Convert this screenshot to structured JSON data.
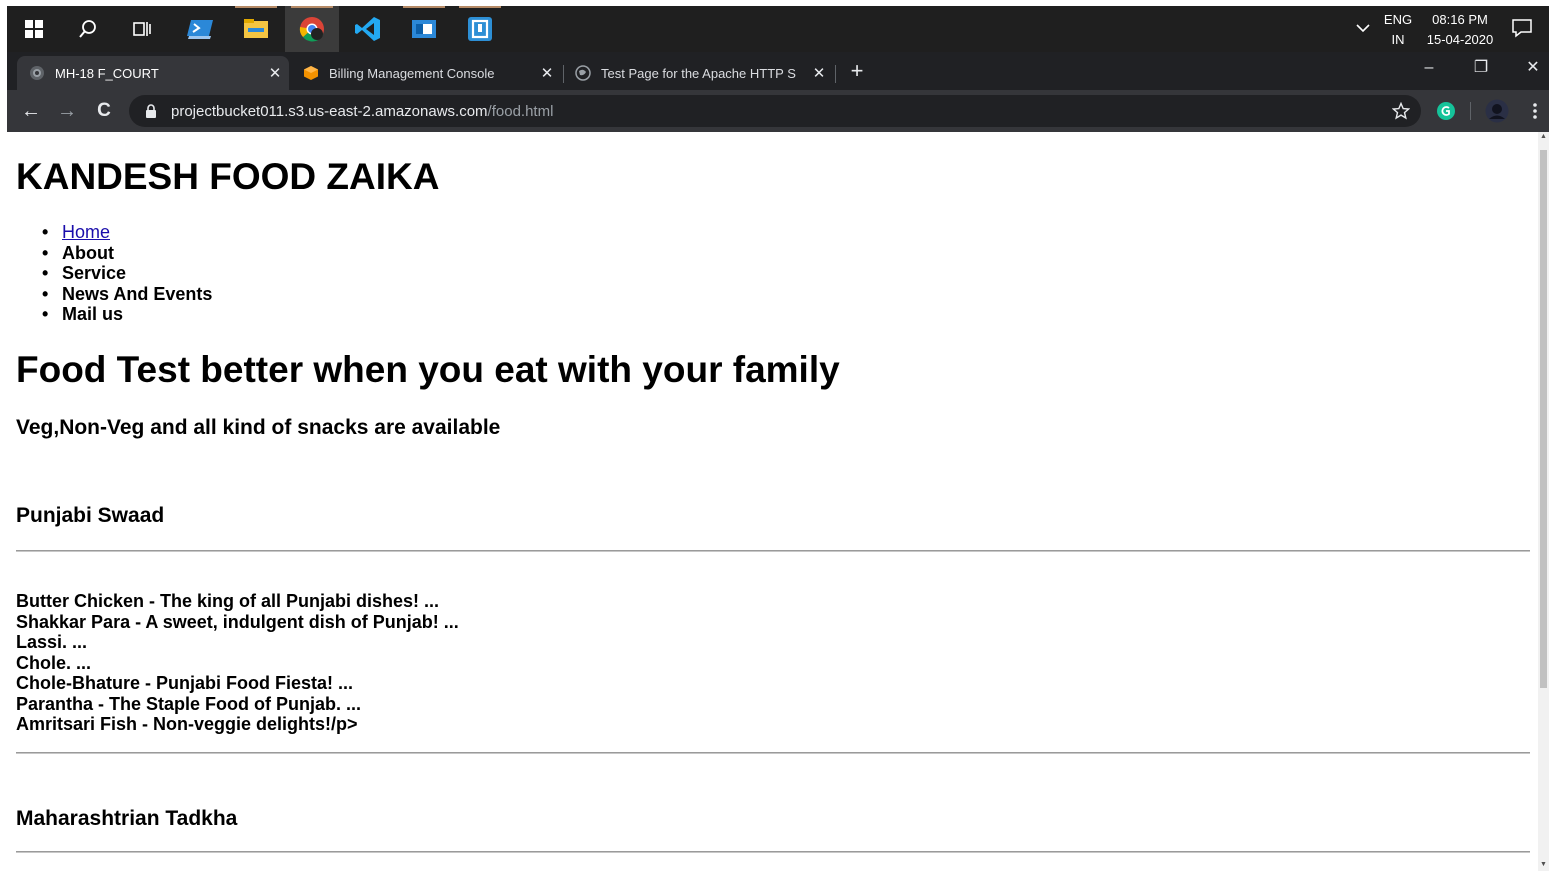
{
  "taskbar": {
    "icons": [
      "windows-start-icon",
      "search-icon",
      "task-view-icon",
      "powershell-icon",
      "file-explorer-icon",
      "chrome-icon",
      "vscode-icon",
      "store-icon",
      "app-icon"
    ],
    "tray": {
      "language_top": "ENG",
      "language_bottom": "IN",
      "time": "08:16 PM",
      "date": "15-04-2020"
    },
    "colors": {
      "bar": "#1f1f1f",
      "active": "#3b3b3b",
      "vscode": "#23a9f2",
      "store": "#2b88d8"
    }
  },
  "browser": {
    "tabs": [
      {
        "title": "MH-18 F_COURT",
        "icon": "globe-icon",
        "active": true
      },
      {
        "title": "Billing Management Console",
        "icon": "aws-icon",
        "active": false
      },
      {
        "title": "Test Page for the Apache HTTP S",
        "icon": "globe-icon",
        "active": false
      }
    ],
    "tab_close_glyph": "✕",
    "new_tab_glyph": "+",
    "window_controls": {
      "minimize": "–",
      "restore": "❐",
      "close": "✕"
    },
    "nav": {
      "back": "←",
      "forward": "→",
      "reload": "C"
    },
    "url_host": "projectbucket011.s3.us-east-2.amazonaws.com",
    "url_path": "/food.html",
    "icons": [
      "lock-icon",
      "star-icon",
      "grammarly-icon",
      "profile-avatar-icon",
      "menu-kebab-icon"
    ],
    "colors": {
      "tabstrip": "#202124",
      "toolbar": "#35363a",
      "omnibox": "#202124",
      "grammarly": "#15c39a"
    }
  },
  "page": {
    "heading": "KANDESH FOOD ZAIKA",
    "nav": [
      "Home",
      "About",
      "Service",
      "News And Events",
      "Mail us"
    ],
    "tagline": "Food Test better when you eat with your family",
    "subheading": "Veg,Non-Veg and all kind of snacks are available",
    "sections": [
      {
        "title": "Punjabi Swaad",
        "items": [
          "Butter Chicken - The king of all Punjabi dishes! ...",
          "Shakkar Para - A sweet, indulgent dish of Punjab! ...",
          "Lassi. ...",
          "Chole. ...",
          "Chole-Bhature - Punjabi Food Fiesta! ...",
          "Parantha - The Staple Food of Punjab. ...",
          "Amritsari Fish - Non-veggie delights!/p>"
        ]
      },
      {
        "title": "Maharashtrian Tadkha",
        "items": []
      }
    ],
    "colors": {
      "link": "#1a0dab",
      "rule": "#c7c7c7"
    }
  }
}
